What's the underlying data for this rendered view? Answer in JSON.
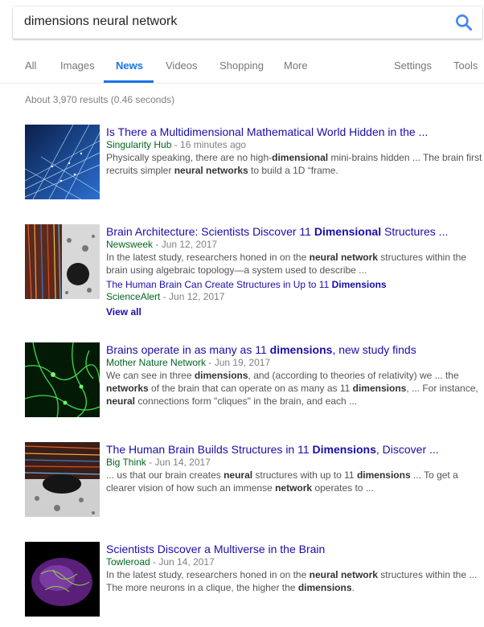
{
  "search": {
    "query": "dimensions neural network"
  },
  "tabs": [
    {
      "label": "All"
    },
    {
      "label": "Images"
    },
    {
      "label": "News"
    },
    {
      "label": "Videos"
    },
    {
      "label": "Shopping"
    },
    {
      "label": "More"
    },
    {
      "label": "Settings"
    },
    {
      "label": "Tools"
    }
  ],
  "active_tab": "News",
  "stats": "About 3,970 results (0.46 seconds)",
  "results": [
    {
      "title": "Is There a Multidimensional Mathematical World Hidden in the ...",
      "source": "Singularity Hub",
      "date": "- 16 minutes ago",
      "snippet": [
        "Physically speaking, there are no high-",
        {
          "b": "dimensional"
        },
        " mini-brains hidden ... The brain first recruits simpler ",
        {
          "b": "neural networks"
        },
        " to build a 1D “frame."
      ]
    },
    {
      "title": [
        "Brain Architecture: Scientists Discover 11 ",
        {
          "b": "Dimensional"
        },
        " Structures ..."
      ],
      "source": "Newsweek",
      "date": "- Jun 12, 2017",
      "snippet": [
        "In the latest study, researchers honed in on the ",
        {
          "b": "neural network"
        },
        " structures within the brain using algebraic topology—a system used to describe ..."
      ],
      "sub": {
        "title": [
          "The Human Brain Can Create Structures in Up to 11 ",
          {
            "b": "Dimensions"
          }
        ],
        "source": "ScienceAlert",
        "date": "- Jun 12, 2017"
      },
      "view_all": "View all"
    },
    {
      "title": [
        "Brains operate in as many as 11 ",
        {
          "b": "dimensions"
        },
        ", new study finds"
      ],
      "source": "Mother Nature Network",
      "date": "- Jun 19, 2017",
      "snippet": [
        "We can see in three ",
        {
          "b": "dimensions"
        },
        ", and (according to theories of relativity) we ... the ",
        {
          "b": "networks"
        },
        " of the brain that can operate on as many as 11 ",
        {
          "b": "dimensions"
        },
        ", ... For instance, ",
        {
          "b": "neural"
        },
        " connections form \"cliques\" in the brain, and each ..."
      ]
    },
    {
      "title": [
        "The Human Brain Builds Structures in 11 ",
        {
          "b": "Dimensions"
        },
        ", Discover ..."
      ],
      "source": "Big Think",
      "date": "- Jun 14, 2017",
      "snippet": [
        "... us that our brain creates ",
        {
          "b": "neural"
        },
        " structures with up to 11 ",
        {
          "b": "dimensions"
        },
        " ... To get a clearer vision of how such an immense ",
        {
          "b": "network"
        },
        " operates to ..."
      ]
    },
    {
      "title": "Scientists Discover a Multiverse in the Brain",
      "source": "Towleroad",
      "date": "- Jun 14, 2017",
      "snippet": [
        "In the latest study, researchers honed in on the ",
        {
          "b": "neural network"
        },
        " structures within the ... The more neurons in a clique, the higher the ",
        {
          "b": "dimensions"
        },
        "."
      ]
    }
  ],
  "colors": {
    "accent": "#1a73e8",
    "link": "#1a0dab",
    "source": "#006621"
  }
}
